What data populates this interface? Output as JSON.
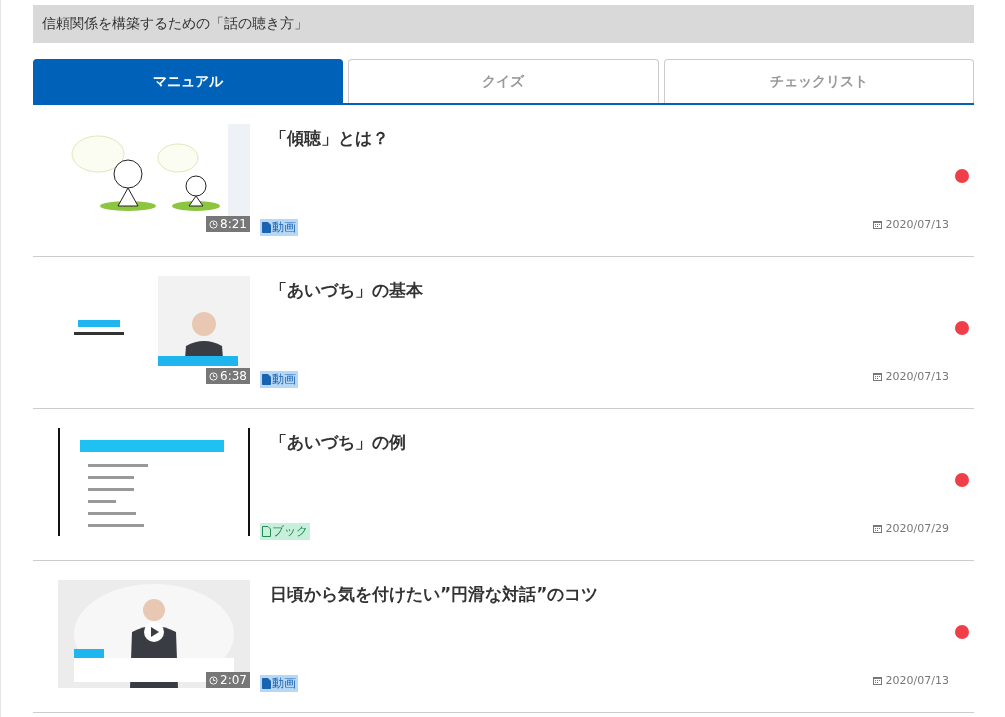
{
  "header": {
    "title": "信頼関係を構築するための「話の聴き方」"
  },
  "tabs": [
    {
      "label": "マニュアル",
      "selected": true
    },
    {
      "label": "クイズ",
      "selected": false
    },
    {
      "label": "チェックリスト",
      "selected": false
    }
  ],
  "items": [
    {
      "title": "「傾聴」とは？",
      "duration": "8:21",
      "badge": "動画",
      "kind": "video",
      "date": "2020/07/13",
      "unread": true
    },
    {
      "title": "「あいづち」の基本",
      "duration": "6:38",
      "badge": "動画",
      "kind": "video",
      "date": "2020/07/13",
      "unread": true
    },
    {
      "title": "「あいづち」の例",
      "badge": "ブック",
      "kind": "book",
      "date": "2020/07/29",
      "unread": true
    },
    {
      "title": "日頃から気を付けたい”円滑な対話”のコツ",
      "duration": "2:07",
      "badge": "動画",
      "kind": "video",
      "date": "2020/07/13",
      "unread": true
    }
  ]
}
